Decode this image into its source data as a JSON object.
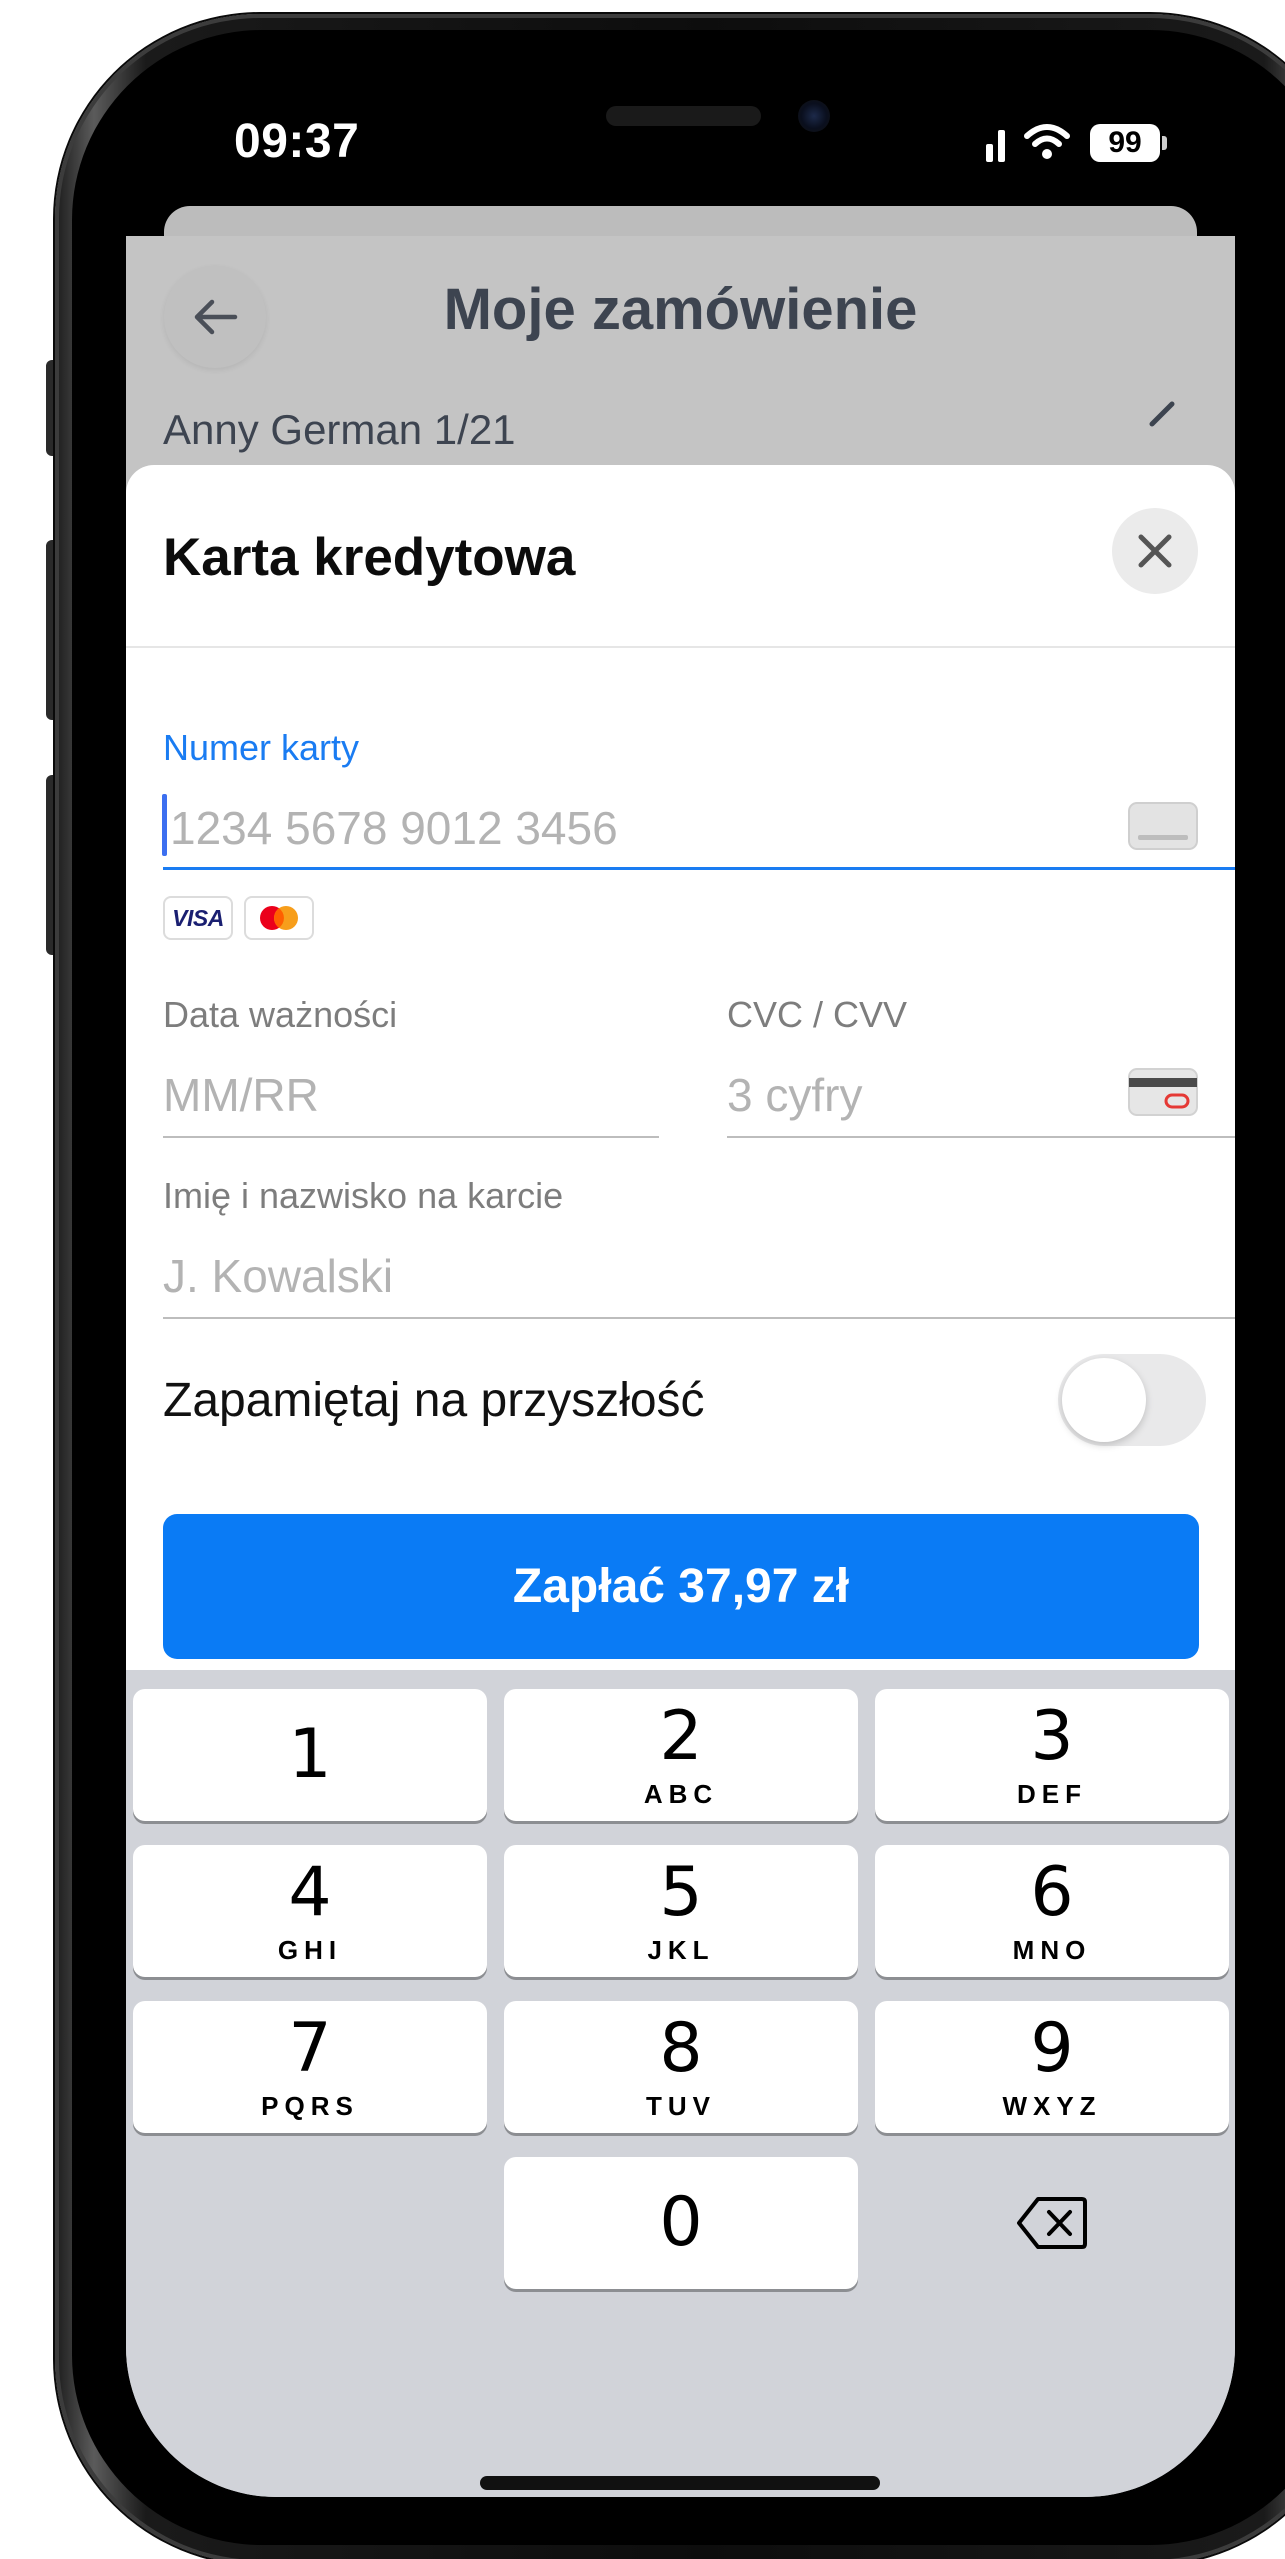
{
  "status_bar": {
    "time": "09:37",
    "battery": "99"
  },
  "page": {
    "title": "Moje zamówienie",
    "address": "Anny German 1/21"
  },
  "modal": {
    "title": "Karta kredytowa",
    "card_number": {
      "label": "Numer karty",
      "placeholder": "1234 5678 9012 3456"
    },
    "card_brands": [
      "VISA",
      "mastercard"
    ],
    "expiry": {
      "label": "Data ważności",
      "placeholder": "MM/RR"
    },
    "cvc": {
      "label": "CVC / CVV",
      "placeholder": "3 cyfry"
    },
    "cardholder": {
      "label": "Imię i nazwisko na karcie",
      "placeholder": "J. Kowalski"
    },
    "remember": {
      "label": "Zapamiętaj na przyszłość",
      "enabled": false
    },
    "pay_button": "Zapłać 37,97 zł"
  },
  "keyboard": {
    "keys": [
      {
        "digit": "1",
        "letters": ""
      },
      {
        "digit": "2",
        "letters": "ABC"
      },
      {
        "digit": "3",
        "letters": "DEF"
      },
      {
        "digit": "4",
        "letters": "GHI"
      },
      {
        "digit": "5",
        "letters": "JKL"
      },
      {
        "digit": "6",
        "letters": "MNO"
      },
      {
        "digit": "7",
        "letters": "PQRS"
      },
      {
        "digit": "8",
        "letters": "TUV"
      },
      {
        "digit": "9",
        "letters": "WXYZ"
      },
      {
        "digit": "0",
        "letters": ""
      }
    ],
    "backspace_icon": "backspace-icon"
  },
  "colors": {
    "accent": "#0a7bf5",
    "active_label": "#1a7cf2",
    "keyboard_bg": "#d1d3d9"
  }
}
